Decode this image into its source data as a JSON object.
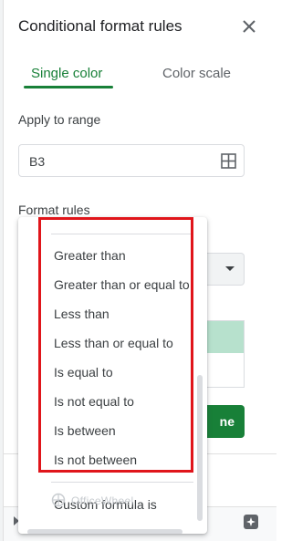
{
  "panel": {
    "title": "Conditional format rules",
    "tabs": [
      {
        "label": "Single color",
        "active": true
      },
      {
        "label": "Color scale",
        "active": false
      }
    ],
    "apply_to_range_label": "Apply to range",
    "range_value": "B3",
    "format_rules_label": "Format rules",
    "done_label": "Done",
    "done_visible_text": "ne"
  },
  "dropdown": {
    "options": [
      "Greater than",
      "Greater than or equal to",
      "Less than",
      "Less than or equal to",
      "Is equal to",
      "Is not equal to",
      "Is between",
      "Is not between"
    ],
    "custom_formula": "Custom formula is"
  },
  "watermark": "OfficeWheel",
  "colors": {
    "accent_green": "#188038",
    "preview_fill": "#b7e1cd",
    "highlight_red": "#e0151b"
  },
  "icons": [
    "close-icon",
    "grid-icon",
    "explore-icon"
  ]
}
